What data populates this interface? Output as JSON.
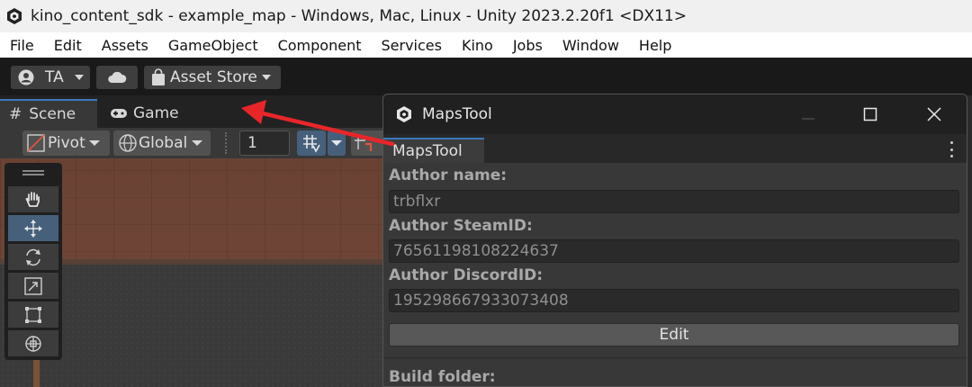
{
  "window": {
    "title": "kino_content_sdk - example_map - Windows, Mac, Linux - Unity 2023.2.20f1 <DX11>"
  },
  "menu": {
    "items": [
      "File",
      "Edit",
      "Assets",
      "GameObject",
      "Component",
      "Services",
      "Kino",
      "Jobs",
      "Window",
      "Help"
    ]
  },
  "toolbar": {
    "account_label": "TA",
    "asset_store_label": "Asset Store"
  },
  "scene_tabs": {
    "scene_label": "Scene",
    "game_label": "Game"
  },
  "scene_toolbar": {
    "pivot_label": "Pivot",
    "global_label": "Global",
    "grid_value": "1"
  },
  "maps_tool": {
    "window_title": "MapsTool",
    "tab_label": "MapsTool",
    "author_name_label": "Author name:",
    "author_name_value": "trbflxr",
    "steam_label": "Author SteamID:",
    "steam_value": "7656119810822463​7",
    "discord_label": "Author DiscordID:",
    "discord_value": "195298667933073408",
    "edit_label": "Edit",
    "build_folder_label": "Build folder:"
  },
  "colors": {
    "accent": "#3a79bb",
    "active_tool": "#46607c",
    "annotation_arrow": "#e8262a"
  }
}
